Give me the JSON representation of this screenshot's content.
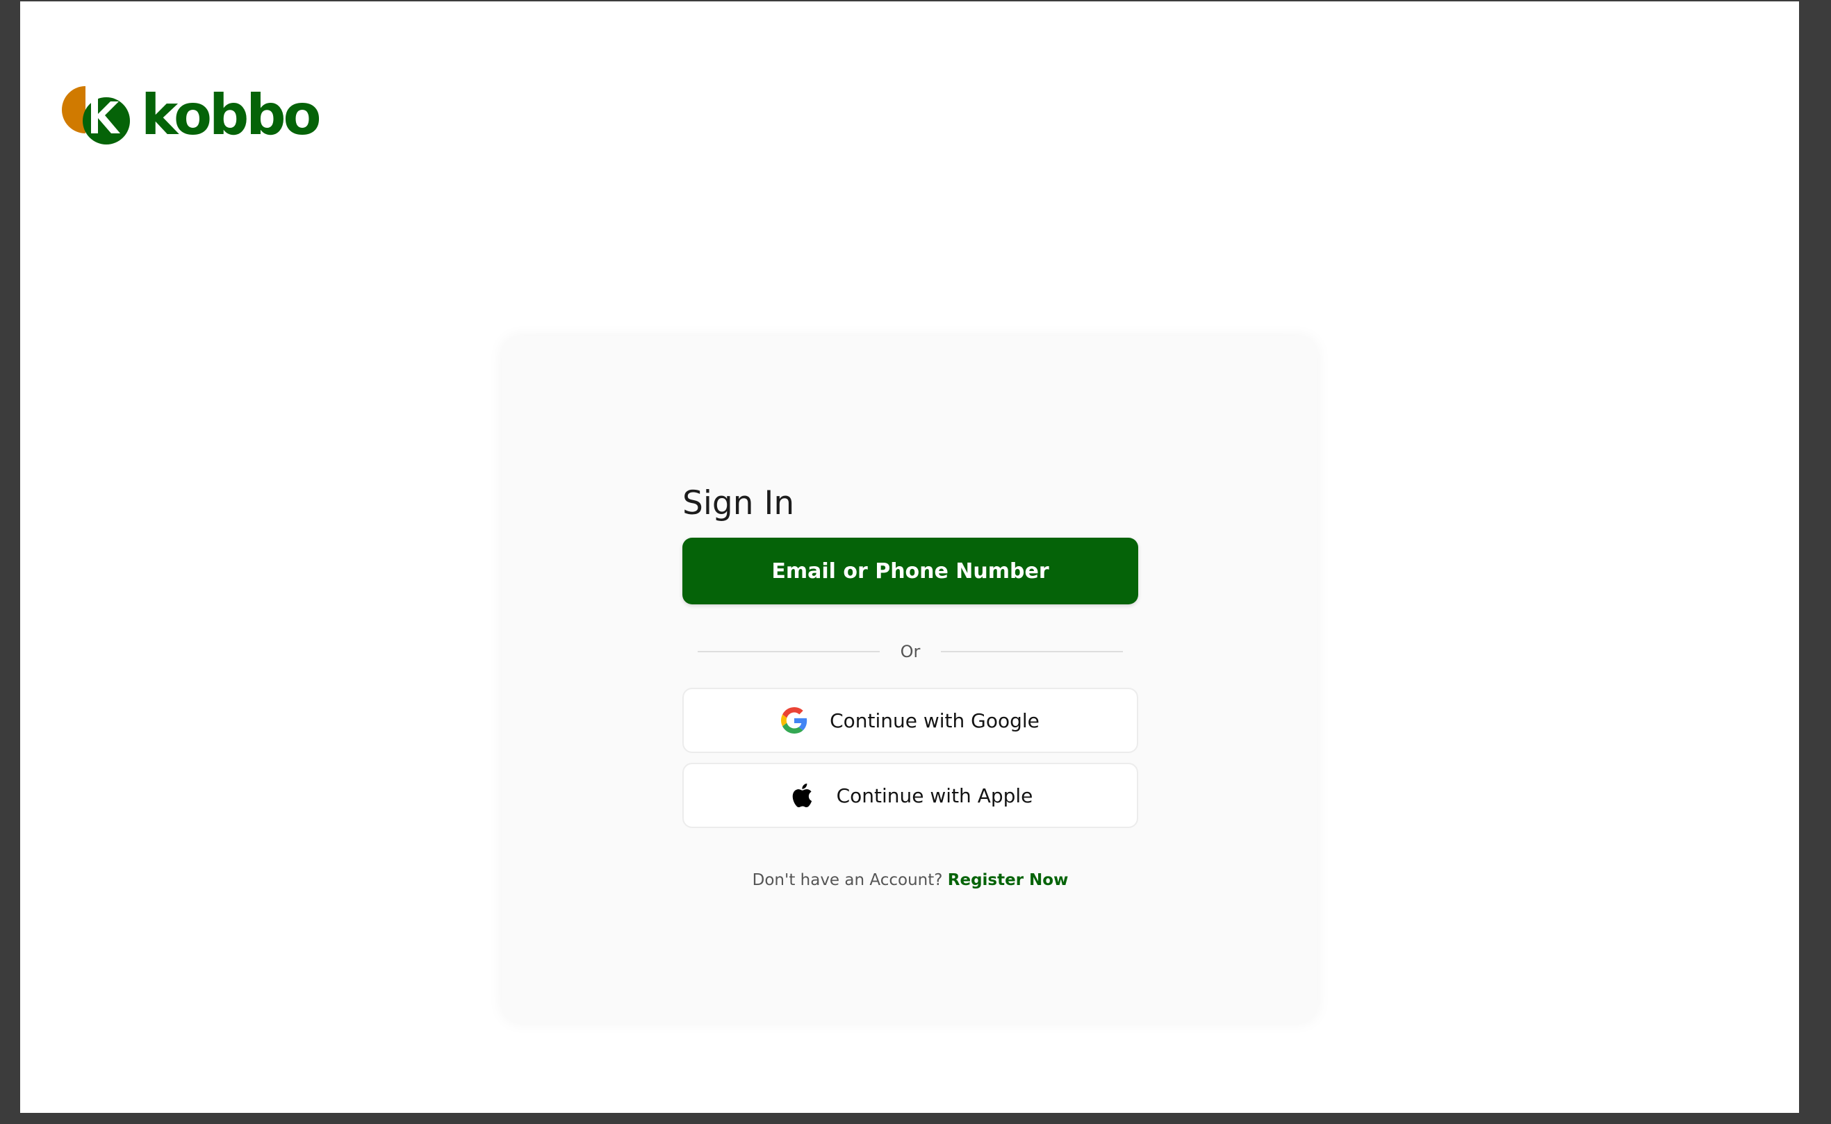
{
  "brand": {
    "name": "kobbo",
    "color_primary": "#056308",
    "color_accent": "#D07A00",
    "logo_icon": "kobbo-logo-icon"
  },
  "signin": {
    "title": "Sign In",
    "email_button": "Email or Phone Number",
    "divider_text": "Or",
    "google_button": "Continue with Google",
    "google_icon": "google-icon",
    "apple_button": "Continue with Apple",
    "apple_icon": "apple-icon",
    "register_prompt": "Don't have an Account?",
    "register_link": "Register Now"
  }
}
